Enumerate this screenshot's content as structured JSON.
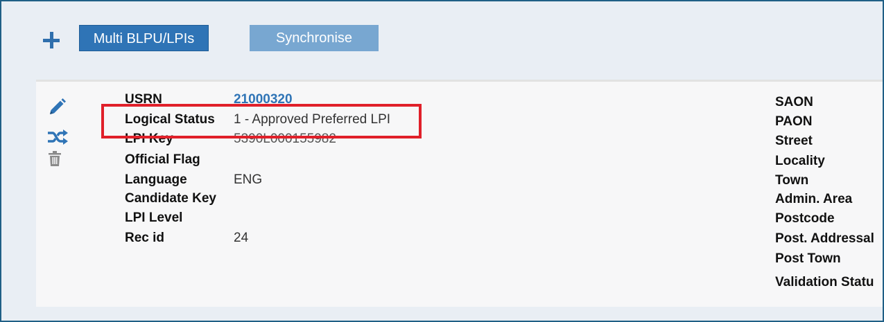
{
  "toolbar": {
    "add_label": "+",
    "multi_button": "Multi BLPU/LPIs",
    "sync_button": "Synchronise"
  },
  "record": {
    "fields": [
      {
        "label": "USRN",
        "value": "21000320"
      },
      {
        "label": "Logical Status",
        "value": "1 - Approved Preferred LPI"
      },
      {
        "label": "LPI Key",
        "value": "5390L000155982"
      },
      {
        "label": "Official Flag",
        "value": ""
      },
      {
        "label": "Language",
        "value": "ENG"
      },
      {
        "label": "Candidate Key",
        "value": ""
      },
      {
        "label": "LPI Level",
        "value": ""
      },
      {
        "label": "Rec id",
        "value": "24"
      }
    ],
    "right_labels": [
      "SAON",
      "PAON",
      "Street",
      "Locality",
      "Town",
      "Admin. Area",
      "Postcode",
      "Post. Addressal",
      "Post Town",
      "Validation Statu"
    ]
  },
  "icons": {
    "edit": "pencil-icon",
    "shuffle": "shuffle-icon",
    "delete": "trash-icon"
  },
  "colors": {
    "accent": "#2f74b6",
    "sync_button": "#78a7d1",
    "highlight": "#e0202a",
    "border": "#1f5f86"
  }
}
